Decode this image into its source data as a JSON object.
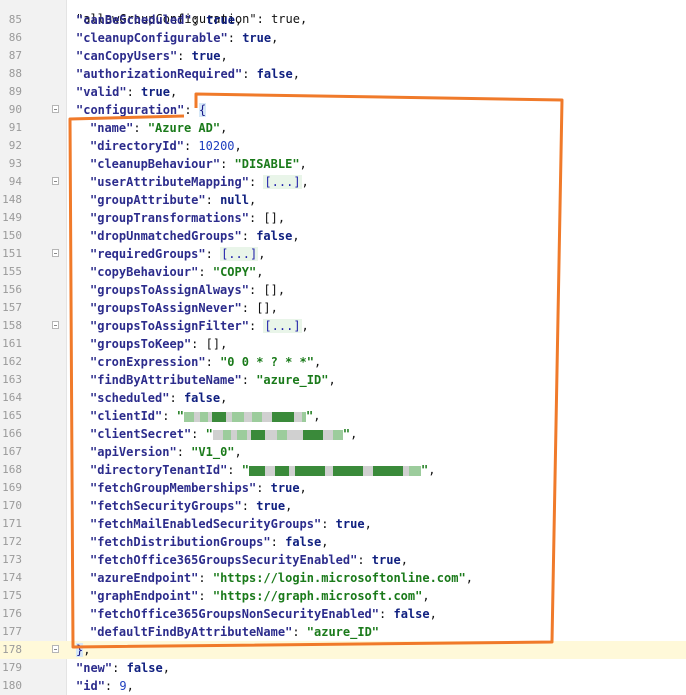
{
  "editor": {
    "partial_top_line": "\"allowGroupConfiguration\": true,",
    "lines": [
      {
        "num": "85",
        "key": "canBeScheduled",
        "vtype": "kw",
        "value": "true",
        "trail": ",",
        "indent": 0
      },
      {
        "num": "86",
        "key": "cleanupConfigurable",
        "vtype": "kw",
        "value": "true",
        "trail": ",",
        "indent": 0
      },
      {
        "num": "87",
        "key": "canCopyUsers",
        "vtype": "kw",
        "value": "true",
        "trail": ",",
        "indent": 0
      },
      {
        "num": "88",
        "key": "authorizationRequired",
        "vtype": "kw",
        "value": "false",
        "trail": ",",
        "indent": 0
      },
      {
        "num": "89",
        "key": "valid",
        "vtype": "kw",
        "value": "true",
        "trail": ",",
        "indent": 0
      },
      {
        "num": "90",
        "key": "configuration",
        "vtype": "open",
        "value": "{",
        "trail": "",
        "indent": 0,
        "fold": true
      },
      {
        "num": "91",
        "key": "name",
        "vtype": "s",
        "value": "\"Azure AD\"",
        "trail": ",",
        "indent": 1
      },
      {
        "num": "92",
        "key": "directoryId",
        "vtype": "n",
        "value": "10200",
        "trail": ",",
        "indent": 1
      },
      {
        "num": "93",
        "key": "cleanupBehaviour",
        "vtype": "s",
        "value": "\"DISABLE\"",
        "trail": ",",
        "indent": 1
      },
      {
        "num": "94",
        "key": "userAttributeMapping",
        "vtype": "col",
        "value": "[...]",
        "trail": ",",
        "indent": 1,
        "fold": true
      },
      {
        "num": "148",
        "key": "groupAttribute",
        "vtype": "kw",
        "value": "null",
        "trail": ",",
        "indent": 1
      },
      {
        "num": "149",
        "key": "groupTransformations",
        "vtype": "p",
        "value": "[]",
        "trail": ",",
        "indent": 1
      },
      {
        "num": "150",
        "key": "dropUnmatchedGroups",
        "vtype": "kw",
        "value": "false",
        "trail": ",",
        "indent": 1
      },
      {
        "num": "151",
        "key": "requiredGroups",
        "vtype": "col",
        "value": "[...]",
        "trail": ",",
        "indent": 1,
        "fold": true
      },
      {
        "num": "155",
        "key": "copyBehaviour",
        "vtype": "s",
        "value": "\"COPY\"",
        "trail": ",",
        "indent": 1
      },
      {
        "num": "156",
        "key": "groupsToAssignAlways",
        "vtype": "p",
        "value": "[]",
        "trail": ",",
        "indent": 1
      },
      {
        "num": "157",
        "key": "groupsToAssignNever",
        "vtype": "p",
        "value": "[]",
        "trail": ",",
        "indent": 1
      },
      {
        "num": "158",
        "key": "groupsToAssignFilter",
        "vtype": "col",
        "value": "[...]",
        "trail": ",",
        "indent": 1,
        "fold": true
      },
      {
        "num": "161",
        "key": "groupsToKeep",
        "vtype": "p",
        "value": "[]",
        "trail": ",",
        "indent": 1
      },
      {
        "num": "162",
        "key": "cronExpression",
        "vtype": "s",
        "value": "\"0 0 * ? * *\"",
        "trail": ",",
        "indent": 1
      },
      {
        "num": "163",
        "key": "findByAttributeName",
        "vtype": "s",
        "value": "\"azure_ID\"",
        "trail": ",",
        "indent": 1
      },
      {
        "num": "164",
        "key": "scheduled",
        "vtype": "kw",
        "value": "false",
        "trail": ",",
        "indent": 1
      },
      {
        "num": "165",
        "key": "clientId",
        "vtype": "redacted",
        "value": "",
        "trail": ",",
        "indent": 1,
        "mask": 1
      },
      {
        "num": "166",
        "key": "clientSecret",
        "vtype": "redacted",
        "value": "",
        "trail": ",",
        "indent": 1,
        "mask": 2
      },
      {
        "num": "167",
        "key": "apiVersion",
        "vtype": "s",
        "value": "\"V1_0\"",
        "trail": ",",
        "indent": 1
      },
      {
        "num": "168",
        "key": "directoryTenantId",
        "vtype": "redacted",
        "value": "",
        "trail": ",",
        "indent": 1,
        "mask": 3
      },
      {
        "num": "169",
        "key": "fetchGroupMemberships",
        "vtype": "kw",
        "value": "true",
        "trail": ",",
        "indent": 1
      },
      {
        "num": "170",
        "key": "fetchSecurityGroups",
        "vtype": "kw",
        "value": "true",
        "trail": ",",
        "indent": 1
      },
      {
        "num": "171",
        "key": "fetchMailEnabledSecurityGroups",
        "vtype": "kw",
        "value": "true",
        "trail": ",",
        "indent": 1
      },
      {
        "num": "172",
        "key": "fetchDistributionGroups",
        "vtype": "kw",
        "value": "false",
        "trail": ",",
        "indent": 1
      },
      {
        "num": "173",
        "key": "fetchOffice365GroupsSecurityEnabled",
        "vtype": "kw",
        "value": "true",
        "trail": ",",
        "indent": 1
      },
      {
        "num": "174",
        "key": "azureEndpoint",
        "vtype": "s",
        "value": "\"https://login.microsoftonline.com\"",
        "trail": ",",
        "indent": 1
      },
      {
        "num": "175",
        "key": "graphEndpoint",
        "vtype": "s",
        "value": "\"https://graph.microsoft.com\"",
        "trail": ",",
        "indent": 1
      },
      {
        "num": "176",
        "key": "fetchOffice365GroupsNonSecurityEnabled",
        "vtype": "kw",
        "value": "false",
        "trail": ",",
        "indent": 1
      },
      {
        "num": "177",
        "key": "defaultFindByAttributeName",
        "vtype": "s",
        "value": "\"azure_ID\"",
        "trail": "",
        "indent": 1
      },
      {
        "num": "178",
        "key": "",
        "vtype": "close",
        "value": "}",
        "trail": ",",
        "indent": 0,
        "current": true,
        "fold": true
      },
      {
        "num": "179",
        "key": "new",
        "vtype": "kw",
        "value": "false",
        "trail": ",",
        "indent": 0
      },
      {
        "num": "180",
        "key": "id",
        "vtype": "n",
        "value": "9",
        "trail": ",",
        "indent": 0
      }
    ]
  },
  "colors": {
    "annotation": "#f07a2a",
    "key": "#2c2c8c",
    "string": "#1a7a1a",
    "number": "#1f3fbf",
    "current_line": "#fff9d9",
    "mask_green_dark": "#3a8a3a",
    "mask_green_light": "#9ccc9c",
    "mask_gray": "#d0d0d0"
  }
}
